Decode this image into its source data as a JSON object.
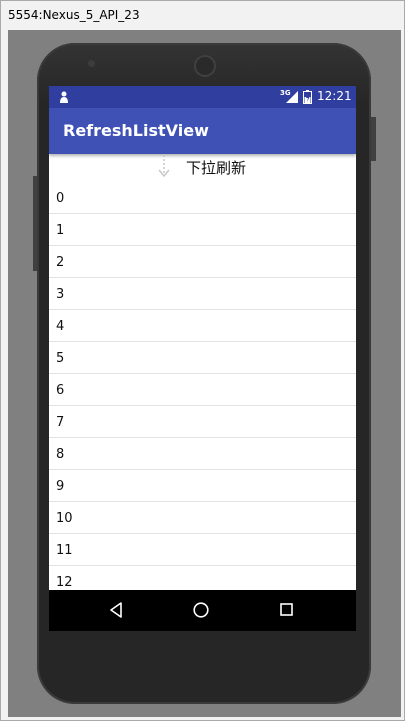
{
  "window": {
    "title": "5554:Nexus_5_API_23"
  },
  "status_bar": {
    "network": "3G",
    "time": "12:21"
  },
  "app_bar": {
    "title": "RefreshListView"
  },
  "refresh_header": {
    "text": "下拉刷新"
  },
  "list": {
    "items": [
      "0",
      "1",
      "2",
      "3",
      "4",
      "5",
      "6",
      "7",
      "8",
      "9",
      "10",
      "11",
      "12"
    ]
  },
  "colors": {
    "status_bar": "#303F9F",
    "app_bar": "#3F51B5",
    "nav_bar": "#000000"
  },
  "icons": {
    "status_left": "person-icon",
    "signal": "signal-icon",
    "battery": "battery-icon",
    "refresh": "down-arrow-icon",
    "back": "back-icon",
    "home": "home-icon",
    "recents": "recents-icon"
  }
}
